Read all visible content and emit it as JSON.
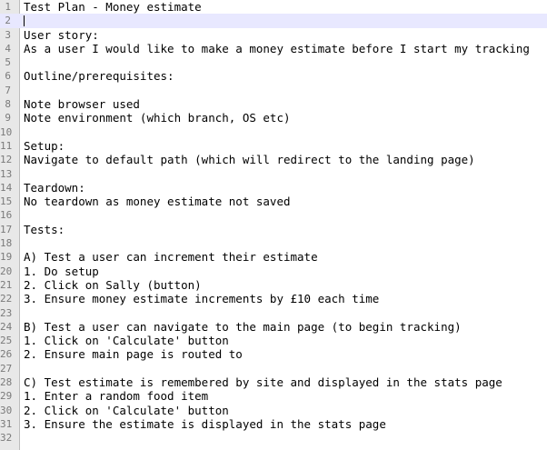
{
  "editor": {
    "current_line": 2,
    "lines": [
      {
        "n": "1",
        "text": "Test Plan - Money estimate"
      },
      {
        "n": "2",
        "text": ""
      },
      {
        "n": "3",
        "text": "User story:"
      },
      {
        "n": "4",
        "text": "As a user I would like to make a money estimate before I start my tracking"
      },
      {
        "n": "5",
        "text": ""
      },
      {
        "n": "6",
        "text": "Outline/prerequisites:"
      },
      {
        "n": "7",
        "text": ""
      },
      {
        "n": "8",
        "text": "Note browser used"
      },
      {
        "n": "9",
        "text": "Note environment (which branch, OS etc)"
      },
      {
        "n": "10",
        "text": ""
      },
      {
        "n": "11",
        "text": "Setup:"
      },
      {
        "n": "12",
        "text": "Navigate to default path (which will redirect to the landing page)"
      },
      {
        "n": "13",
        "text": ""
      },
      {
        "n": "14",
        "text": "Teardown:"
      },
      {
        "n": "15",
        "text": "No teardown as money estimate not saved"
      },
      {
        "n": "16",
        "text": ""
      },
      {
        "n": "17",
        "text": "Tests:"
      },
      {
        "n": "18",
        "text": ""
      },
      {
        "n": "19",
        "text": "A) Test a user can increment their estimate"
      },
      {
        "n": "20",
        "text": "1. Do setup"
      },
      {
        "n": "21",
        "text": "2. Click on Sally (button)"
      },
      {
        "n": "22",
        "text": "3. Ensure money estimate increments by £10 each time"
      },
      {
        "n": "23",
        "text": ""
      },
      {
        "n": "24",
        "text": "B) Test a user can navigate to the main page (to begin tracking)"
      },
      {
        "n": "25",
        "text": "1. Click on 'Calculate' button"
      },
      {
        "n": "26",
        "text": "2. Ensure main page is routed to"
      },
      {
        "n": "27",
        "text": ""
      },
      {
        "n": "28",
        "text": "C) Test estimate is remembered by site and displayed in the stats page"
      },
      {
        "n": "29",
        "text": "1. Enter a random food item"
      },
      {
        "n": "30",
        "text": "2. Click on 'Calculate' button"
      },
      {
        "n": "31",
        "text": "3. Ensure the estimate is displayed in the stats page"
      },
      {
        "n": "32",
        "text": ""
      }
    ]
  }
}
